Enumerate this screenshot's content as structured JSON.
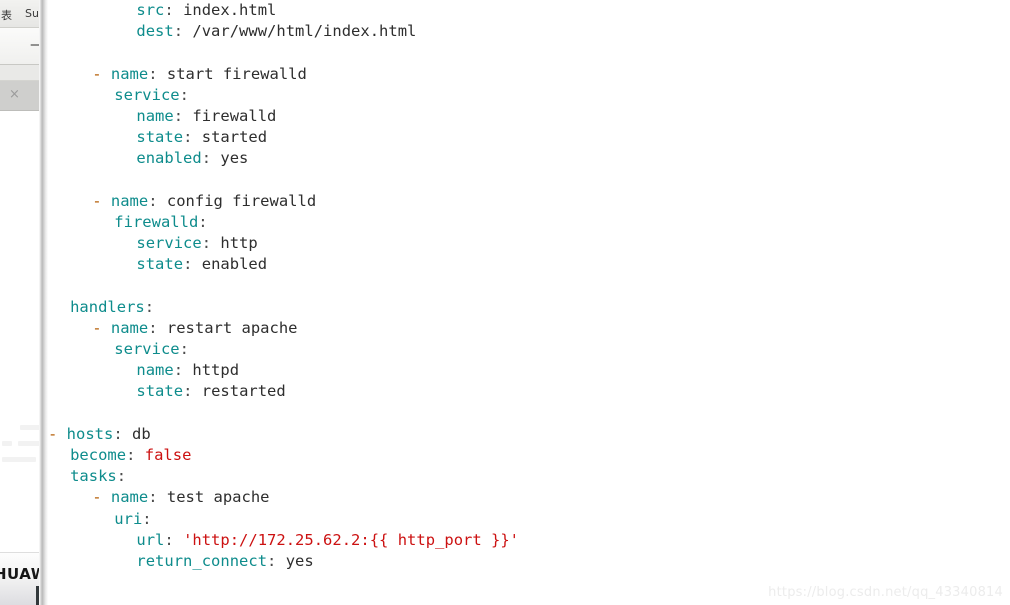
{
  "background_window": {
    "menubar": {
      "glyph": "表",
      "item_label": "Su"
    },
    "minimize_label": "—",
    "tab_close_label": "×",
    "taskbar_brand": "HUAWEI"
  },
  "editor": {
    "language": "yaml",
    "colors": {
      "key": "#0e8c8c",
      "value": "#2e2e2e",
      "string": "#cc1111",
      "boolean": "#cc1111",
      "dash": "#b35a00",
      "punctuation": "#4c4c4c",
      "background": "#ffffff"
    },
    "lines": [
      {
        "indent": 8,
        "dash": false,
        "key": "src",
        "sep": ":",
        "value": "index.html",
        "value_type": "plain"
      },
      {
        "indent": 8,
        "dash": false,
        "key": "dest",
        "sep": ":",
        "value": "/var/www/html/index.html",
        "value_type": "plain"
      },
      {
        "indent": 0,
        "dash": false,
        "key": "",
        "sep": "",
        "value": "",
        "value_type": "blank"
      },
      {
        "indent": 4,
        "dash": true,
        "key": "name",
        "sep": ":",
        "value": "start firewalld",
        "value_type": "plain"
      },
      {
        "indent": 6,
        "dash": false,
        "key": "service",
        "sep": ":",
        "value": "",
        "value_type": "plain"
      },
      {
        "indent": 8,
        "dash": false,
        "key": "name",
        "sep": ":",
        "value": "firewalld",
        "value_type": "plain"
      },
      {
        "indent": 8,
        "dash": false,
        "key": "state",
        "sep": ":",
        "value": "started",
        "value_type": "plain"
      },
      {
        "indent": 8,
        "dash": false,
        "key": "enabled",
        "sep": ":",
        "value": "yes",
        "value_type": "plain"
      },
      {
        "indent": 0,
        "dash": false,
        "key": "",
        "sep": "",
        "value": "",
        "value_type": "blank"
      },
      {
        "indent": 4,
        "dash": true,
        "key": "name",
        "sep": ":",
        "value": "config firewalld",
        "value_type": "plain"
      },
      {
        "indent": 6,
        "dash": false,
        "key": "firewalld",
        "sep": ":",
        "value": "",
        "value_type": "plain"
      },
      {
        "indent": 8,
        "dash": false,
        "key": "service",
        "sep": ":",
        "value": "http",
        "value_type": "plain"
      },
      {
        "indent": 8,
        "dash": false,
        "key": "state",
        "sep": ":",
        "value": "enabled",
        "value_type": "plain"
      },
      {
        "indent": 0,
        "dash": false,
        "key": "",
        "sep": "",
        "value": "",
        "value_type": "blank"
      },
      {
        "indent": 2,
        "dash": false,
        "key": "handlers",
        "sep": ":",
        "value": "",
        "value_type": "plain"
      },
      {
        "indent": 4,
        "dash": true,
        "key": "name",
        "sep": ":",
        "value": "restart apache",
        "value_type": "plain"
      },
      {
        "indent": 6,
        "dash": false,
        "key": "service",
        "sep": ":",
        "value": "",
        "value_type": "plain"
      },
      {
        "indent": 8,
        "dash": false,
        "key": "name",
        "sep": ":",
        "value": "httpd",
        "value_type": "plain"
      },
      {
        "indent": 8,
        "dash": false,
        "key": "state",
        "sep": ":",
        "value": "restarted",
        "value_type": "plain"
      },
      {
        "indent": 0,
        "dash": false,
        "key": "",
        "sep": "",
        "value": "",
        "value_type": "blank"
      },
      {
        "indent": 0,
        "dash": true,
        "key": "hosts",
        "sep": ":",
        "value": "db",
        "value_type": "plain"
      },
      {
        "indent": 2,
        "dash": false,
        "key": "become",
        "sep": ":",
        "value": "false",
        "value_type": "bool"
      },
      {
        "indent": 2,
        "dash": false,
        "key": "tasks",
        "sep": ":",
        "value": "",
        "value_type": "plain"
      },
      {
        "indent": 4,
        "dash": true,
        "key": "name",
        "sep": ":",
        "value": "test apache",
        "value_type": "plain"
      },
      {
        "indent": 6,
        "dash": false,
        "key": "uri",
        "sep": ":",
        "value": "",
        "value_type": "plain"
      },
      {
        "indent": 8,
        "dash": false,
        "key": "url",
        "sep": ":",
        "value": "'http://172.25.62.2:{{ http_port }}'",
        "value_type": "string"
      },
      {
        "indent": 8,
        "dash": false,
        "key": "return_connect",
        "sep": ":",
        "value": "yes",
        "value_type": "plain"
      }
    ]
  },
  "watermark": {
    "text": "https://blog.csdn.net/qq_43340814"
  }
}
